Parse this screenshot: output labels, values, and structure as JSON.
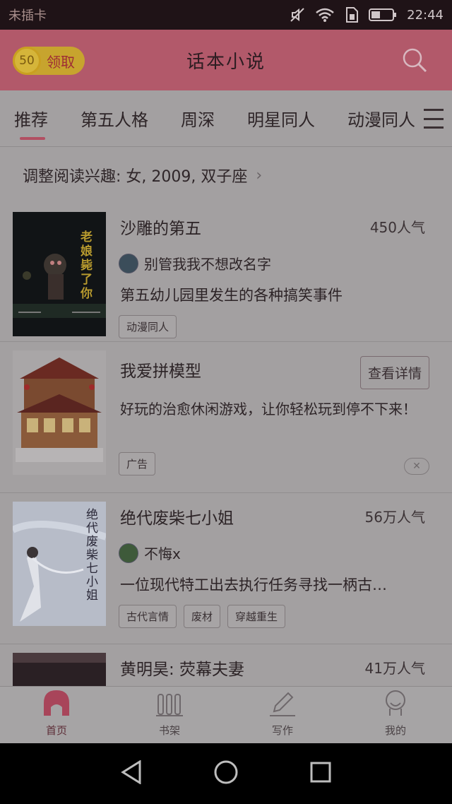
{
  "status_bar": {
    "carrier": "未插卡",
    "time": "22:44"
  },
  "header": {
    "coin_value": "50",
    "coin_label": "领取",
    "title": "话本小说"
  },
  "tabs": [
    {
      "label": "推荐",
      "active": true
    },
    {
      "label": "第五人格",
      "active": false
    },
    {
      "label": "周深",
      "active": false
    },
    {
      "label": "明星同人",
      "active": false
    },
    {
      "label": "动漫同人",
      "active": false
    }
  ],
  "interest": {
    "text": "调整阅读兴趣: 女, 2009, 双子座"
  },
  "books": [
    {
      "title": "沙雕的第五",
      "popularity": "450人气",
      "author": "别管我我不想改名字",
      "description": "第五幼儿园里发生的各种搞笑事件",
      "tags": [
        "动漫同人"
      ],
      "cover_text": "老娘毙了你"
    },
    {
      "title": "绝代废柴七小姐",
      "popularity": "56万人气",
      "author": "不悔x",
      "description": "一位现代特工出去执行任务寻找一柄古…",
      "tags": [
        "古代言情",
        "废材",
        "穿越重生"
      ],
      "cover_text": "绝代废柴七小姐"
    },
    {
      "title": "黄明昊: 荧幕夫妻",
      "popularity": "41万人气"
    }
  ],
  "ad": {
    "title": "我爱拼模型",
    "detail_button": "查看详情",
    "description": "好玩的治愈休闲游戏，让你轻松玩到停不下来！",
    "tag": "广告"
  },
  "bottom_nav": [
    {
      "label": "首页",
      "icon": "home-icon",
      "active": true
    },
    {
      "label": "书架",
      "icon": "bookshelf-icon",
      "active": false
    },
    {
      "label": "写作",
      "icon": "pen-icon",
      "active": false
    },
    {
      "label": "我的",
      "icon": "profile-icon",
      "active": false
    }
  ],
  "colors": {
    "header_bg": "#b2596a",
    "accent": "#b24f62",
    "coin": "#c7a42e"
  }
}
